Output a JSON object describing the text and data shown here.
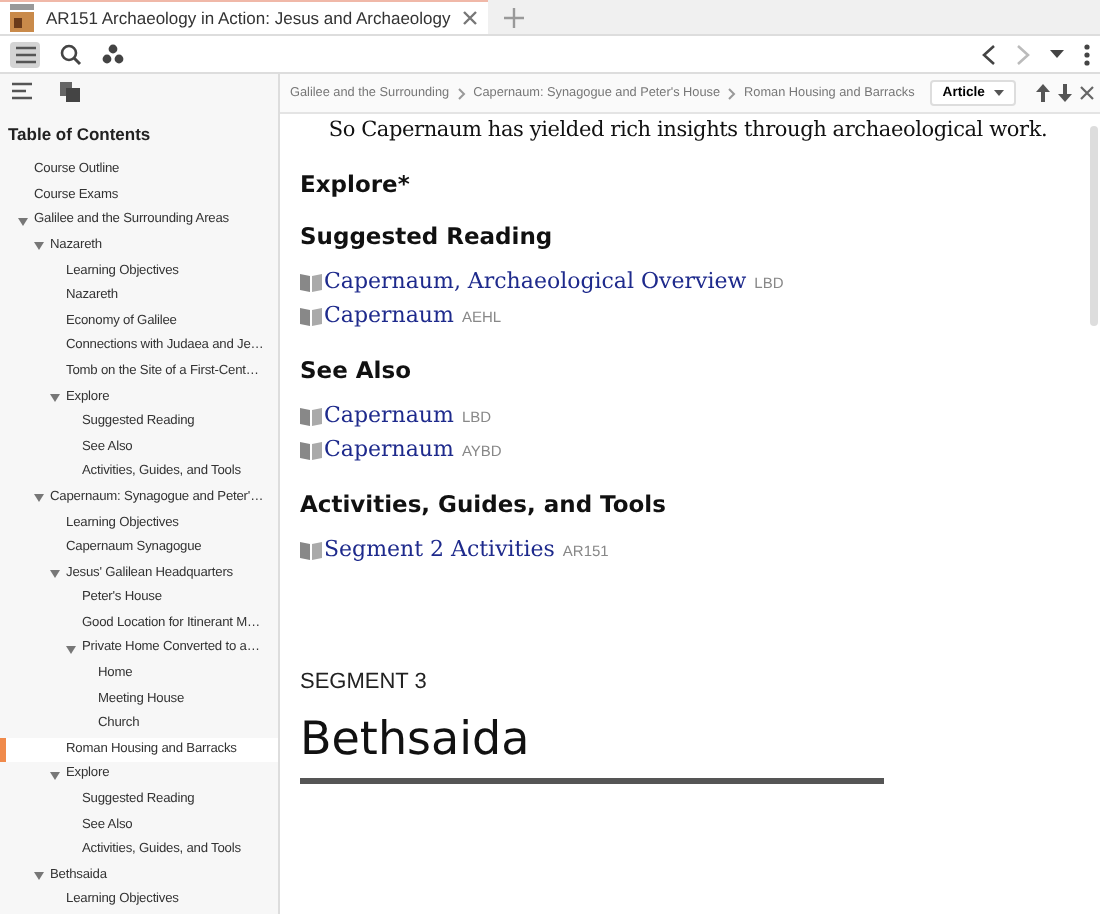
{
  "tab": {
    "title": "AR151 Archaeology in Action: Jesus and Archaeology",
    "selected": true
  },
  "breadcrumbs": [
    "Galilee and the Surrounding",
    "Capernaum: Synagogue and Peter's House",
    "Roman Housing and Barracks"
  ],
  "view_menu": {
    "label": "Article"
  },
  "toc": {
    "title": "Table of Contents",
    "items": [
      {
        "label": "Course Outline",
        "selected": false
      },
      {
        "label": "Course Exams",
        "selected": false
      },
      {
        "label": "Galilee and the Surrounding Areas",
        "selected": false,
        "expanded": true,
        "children": [
          {
            "label": "Nazareth",
            "selected": false,
            "expanded": true,
            "children": [
              {
                "label": "Learning Objectives",
                "selected": false
              },
              {
                "label": "Nazareth",
                "selected": false
              },
              {
                "label": "Economy of Galilee",
                "selected": false
              },
              {
                "label": "Connections with Judaea and Je…",
                "selected": false
              },
              {
                "label": "Tomb on the Site of a First-Cent…",
                "selected": false
              },
              {
                "label": "Explore",
                "selected": false,
                "expanded": true,
                "children": [
                  {
                    "label": "Suggested Reading",
                    "selected": false
                  },
                  {
                    "label": "See Also",
                    "selected": false
                  },
                  {
                    "label": "Activities, Guides, and Tools",
                    "selected": false
                  }
                ]
              }
            ]
          },
          {
            "label": "Capernaum: Synagogue and Peter'…",
            "selected": false,
            "expanded": true,
            "children": [
              {
                "label": "Learning Objectives",
                "selected": false
              },
              {
                "label": "Capernaum Synagogue",
                "selected": false
              },
              {
                "label": "Jesus' Galilean Headquarters",
                "selected": false,
                "expanded": true,
                "children": [
                  {
                    "label": "Peter's House",
                    "selected": false
                  },
                  {
                    "label": "Good Location for Itinerant M…",
                    "selected": false
                  },
                  {
                    "label": "Private Home Converted to a…",
                    "selected": false,
                    "expanded": true,
                    "children": [
                      {
                        "label": "Home",
                        "selected": false
                      },
                      {
                        "label": "Meeting House",
                        "selected": false
                      },
                      {
                        "label": "Church",
                        "selected": false
                      }
                    ]
                  }
                ]
              },
              {
                "label": "Roman Housing and Barracks",
                "selected": true
              },
              {
                "label": "Explore",
                "selected": false,
                "expanded": true,
                "children": [
                  {
                    "label": "Suggested Reading",
                    "selected": false
                  },
                  {
                    "label": "See Also",
                    "selected": false
                  },
                  {
                    "label": "Activities, Guides, and Tools",
                    "selected": false
                  }
                ]
              }
            ]
          },
          {
            "label": "Bethsaida",
            "selected": false,
            "expanded": true,
            "children": [
              {
                "label": "Learning Objectives",
                "selected": false
              }
            ]
          }
        ]
      }
    ]
  },
  "article": {
    "intro": "So Capernaum has yielded rich insights through archaeological work.",
    "explore_heading": "Explore*",
    "sections": [
      {
        "heading": "Suggested Reading",
        "links": [
          {
            "title": "Capernaum, Archaeological Overview",
            "source": "LBD"
          },
          {
            "title": "Capernaum",
            "source": "AEHL"
          }
        ]
      },
      {
        "heading": "See Also",
        "links": [
          {
            "title": "Capernaum",
            "source": "LBD"
          },
          {
            "title": "Capernaum",
            "source": "AYBD"
          }
        ]
      },
      {
        "heading": "Activities, Guides, and Tools",
        "links": [
          {
            "title": "Segment 2 Activities",
            "source": "AR151"
          }
        ]
      }
    ],
    "segment_label": "SEGMENT 3",
    "segment_title": "Bethsaida"
  }
}
